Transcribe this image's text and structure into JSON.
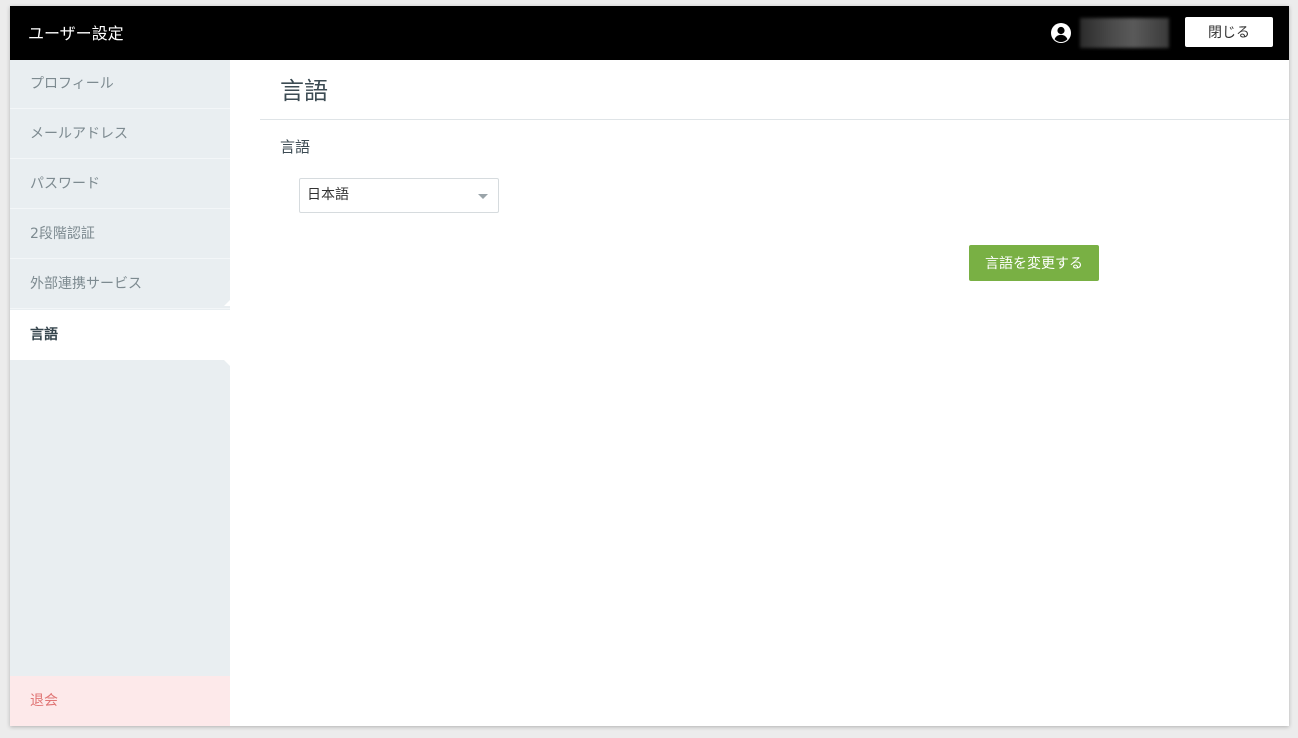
{
  "header": {
    "app_title": "ユーザー設定",
    "user_icon": "user-circle-icon",
    "close_label": "閉じる"
  },
  "sidebar": {
    "items": [
      {
        "label": "プロフィール",
        "active": false
      },
      {
        "label": "メールアドレス",
        "active": false
      },
      {
        "label": "パスワード",
        "active": false
      },
      {
        "label": "2段階認証",
        "active": false
      },
      {
        "label": "外部連携サービス",
        "active": false
      },
      {
        "label": "言語",
        "active": true
      }
    ],
    "withdraw_label": "退会"
  },
  "main": {
    "page_title": "言語",
    "field_label": "言語",
    "language_select": {
      "selected": "日本語"
    },
    "submit_label": "言語を変更する"
  },
  "colors": {
    "topbar": "#000000",
    "sidebar_bg": "#e9eef1",
    "withdraw_bg": "#fde9ea",
    "withdraw_text": "#e07575",
    "accent_green": "#79b044",
    "title_text": "#3c4b53"
  }
}
